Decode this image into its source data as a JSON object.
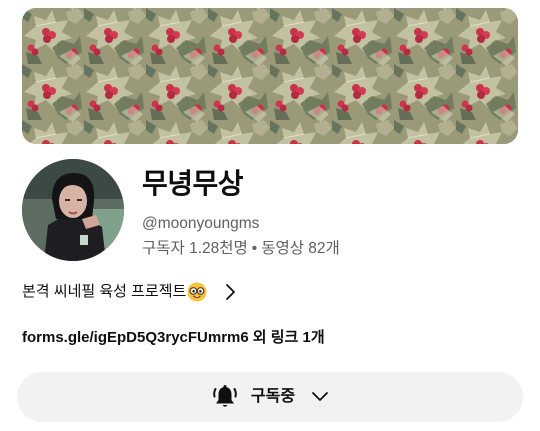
{
  "channel": {
    "name": "무녕무상",
    "handle": "@moonyoungms",
    "subscribers": "구독자 1.28천명",
    "separator": "•",
    "videos": "동영상 82개"
  },
  "description": {
    "text": "본격 씨네필 육성 프로젝트",
    "emoji_icon": "nerd-face-emoji"
  },
  "links": {
    "primary": "forms.gle/igEpD5Q3rycFUmrm6",
    "extra": "외 링크 1개"
  },
  "subscribe": {
    "label": "구독중",
    "icon": "bell-ringing-icon",
    "dropdown_icon": "chevron-down-icon"
  }
}
